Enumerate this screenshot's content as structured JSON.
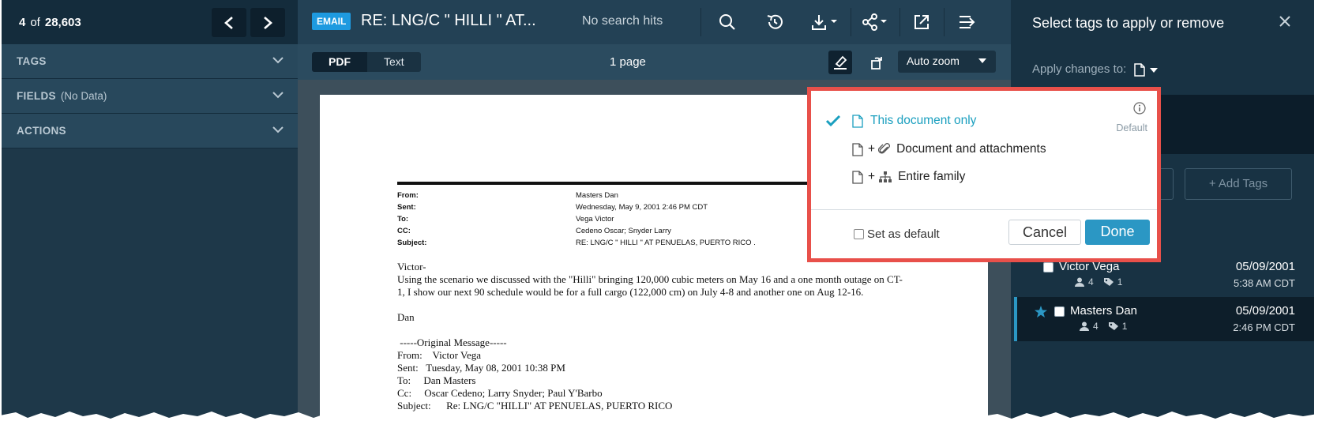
{
  "nav": {
    "position": "4",
    "of_label": "of",
    "total": "28,603"
  },
  "sections": [
    {
      "label": "TAGS",
      "sub": ""
    },
    {
      "label": "FIELDS",
      "sub": "(No Data)"
    },
    {
      "label": "ACTIONS",
      "sub": ""
    }
  ],
  "viewer": {
    "badge": "EMAIL",
    "title": "RE: LNG/C \" HILLI \" AT...",
    "search_status": "No search hits",
    "view_modes": [
      "PDF",
      "Text"
    ],
    "active_mode": "PDF",
    "page_count": "1 page",
    "zoom": "Auto zoom"
  },
  "email": {
    "headers": [
      {
        "label": "From:",
        "value": "Masters  Dan"
      },
      {
        "label": "Sent:",
        "value": "Wednesday, May 9, 2001 2:46 PM CDT"
      },
      {
        "label": "To:",
        "value": "Vega  Victor"
      },
      {
        "label": "CC:",
        "value": "Cedeno  Oscar; Snyder  Larry"
      },
      {
        "label": "Subject:",
        "value": "RE: LNG/C \" HILLI \" AT PENUELAS, PUERTO RICO ."
      }
    ],
    "greeting": "Victor-",
    "body": "Using the scenario we discussed with the \"Hilli\" bringing 120,000 cubic meters on May 16 and a one month outage on CT-1, I show our next 90 schedule would be for a full cargo (122,000 cm) on July 4-8 and another one on Aug 12-16.",
    "signoff": "Dan",
    "original_header": " -----Original Message-----",
    "original_lines": [
      "From:    Victor Vega",
      "Sent:   Tuesday, May 08, 2001 10:38 PM",
      "To:     Dan Masters",
      "Cc:     Oscar Cedeno; Larry Snyder; Paul Y'Barbo",
      "Subject:      Re: LNG/C \"HILLI\" AT PENUELAS, PUERTO RICO"
    ]
  },
  "tag_panel": {
    "title": "Select tags to apply or remove",
    "apply_label": "Apply changes to:",
    "add_tags_label": "+ Add Tags"
  },
  "popup": {
    "options": [
      {
        "label": "This document only",
        "selected": true
      },
      {
        "label": "Document and attachments",
        "selected": false
      },
      {
        "label": "Entire family",
        "selected": false
      }
    ],
    "default_label": "Default",
    "set_default_label": "Set as default",
    "cancel_label": "Cancel",
    "done_label": "Done"
  },
  "thread": [
    {
      "name": "Victor Vega",
      "people": "4",
      "tags": "1",
      "date": "05/09/2001",
      "time": "5:38 AM CDT",
      "starred": false
    },
    {
      "name": "Masters Dan",
      "people": "4",
      "tags": "1",
      "date": "05/09/2001",
      "time": "2:46 PM CDT",
      "starred": true
    }
  ],
  "colors": {
    "accent": "#2b97c4",
    "highlight": "#e8504a",
    "selected_option": "#1a9fbf",
    "badge": "#1e9ae0"
  }
}
